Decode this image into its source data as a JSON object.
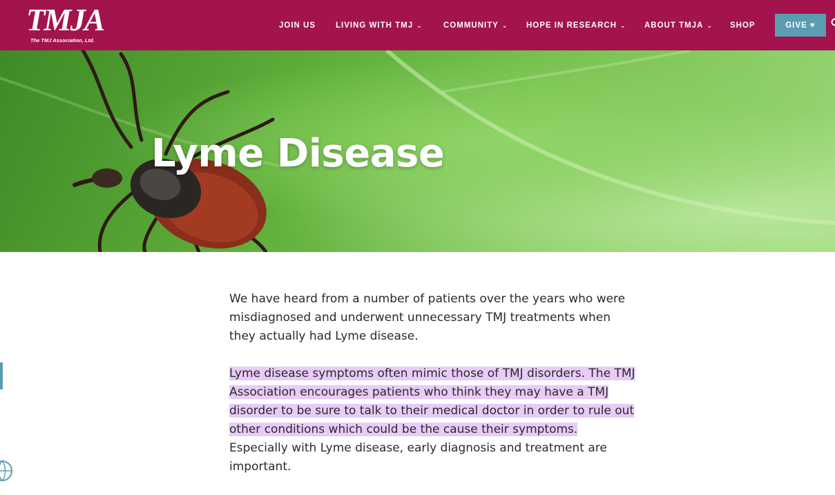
{
  "brand": {
    "logo_text": "TMJA",
    "logo_subtext": "The TMJ Association, Ltd."
  },
  "nav": {
    "items": [
      {
        "label": "JOIN US"
      },
      {
        "label": "LIVING WITH TMJ"
      },
      {
        "label": "COMMUNITY"
      },
      {
        "label": "HOPE IN RESEARCH"
      },
      {
        "label": "ABOUT TMJA"
      },
      {
        "label": "SHOP"
      }
    ],
    "give_label": "GIVE ♥"
  },
  "hero": {
    "title": "Lyme Disease"
  },
  "content": {
    "paragraph1": "We have heard from a number of patients over the years who were misdiagnosed and underwent unnecessary TMJ treatments when they actually had Lyme disease.",
    "paragraph2_highlight": "Lyme disease symptoms often mimic those of TMJ disorders. The TMJ Association encourages patients who think they may have a TMJ disorder to be sure to talk to their medical doctor in order to rule out other conditions which could be the cause their symptoms.",
    "paragraph2_rest": " Especially with Lyme disease, early diagnosis and treatment are important."
  },
  "colors": {
    "header_bg": "#a3134e",
    "accent": "#5a9db0",
    "highlight": "#e8cbf7"
  },
  "icons": [
    "chevron-down-icon",
    "heart-icon",
    "search-icon",
    "globe-icon"
  ]
}
